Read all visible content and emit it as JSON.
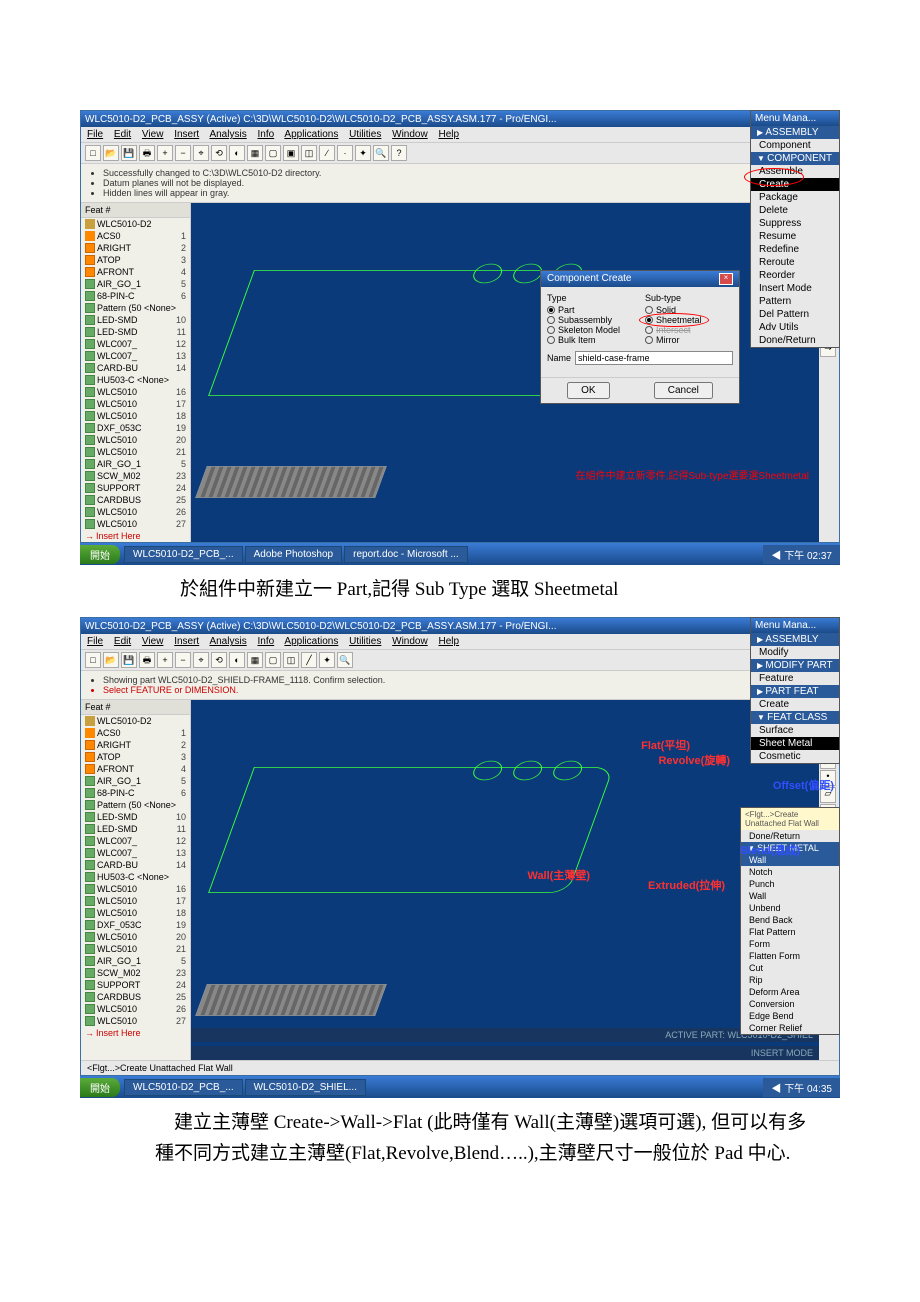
{
  "caption1": "於組件中新建立一 Part,記得 Sub Type 選取 Sheetmetal",
  "caption2": "    建立主薄壁 Create->Wall->Flat (此時僅有 Wall(主薄壁)選項可選), 但可以有多種不同方式建立主薄壁(Flat,Revolve,Blend…..),主薄壁尺寸一般位於 Pad 中心.",
  "shot1": {
    "title": "WLC5010-D2_PCB_ASSY (Active)  C:\\3D\\WLC5010-D2\\WLC5010-D2_PCB_ASSY.ASM.177 - Pro/ENGI...",
    "menus": [
      "File",
      "Edit",
      "View",
      "Insert",
      "Analysis",
      "Info",
      "Applications",
      "Utilities",
      "Window",
      "Help"
    ],
    "messages": [
      "Successfully changed to C:\\3D\\WLC5010-D2 directory.",
      "Datum planes will not be displayed.",
      "Hidden lines will appear in gray."
    ],
    "feat_head": "Feat #",
    "tree": [
      {
        "label": "WLC5010-D2",
        "t": "asm",
        "n": ""
      },
      {
        "label": "ACS0",
        "t": "csys",
        "n": "1"
      },
      {
        "label": "ARIGHT",
        "t": "plane",
        "n": "2"
      },
      {
        "label": "ATOP",
        "t": "plane",
        "n": "3"
      },
      {
        "label": "AFRONT",
        "t": "plane",
        "n": "4"
      },
      {
        "label": "AIR_GO_1",
        "t": "part",
        "n": "5"
      },
      {
        "label": "68-PIN-C",
        "t": "part",
        "n": "6"
      },
      {
        "label": "Pattern (50  <None>",
        "t": "grp",
        "n": ""
      },
      {
        "label": "LED-SMD",
        "t": "part",
        "n": "10"
      },
      {
        "label": "LED-SMD",
        "t": "part",
        "n": "11"
      },
      {
        "label": "WLC007_",
        "t": "part",
        "n": "12"
      },
      {
        "label": "WLC007_",
        "t": "part",
        "n": "13"
      },
      {
        "label": "CARD-BU",
        "t": "part",
        "n": "14"
      },
      {
        "label": "HU503-C  <None>",
        "t": "part",
        "n": ""
      },
      {
        "label": "WLC5010",
        "t": "part",
        "n": "16"
      },
      {
        "label": "WLC5010",
        "t": "part",
        "n": "17"
      },
      {
        "label": "WLC5010",
        "t": "part",
        "n": "18"
      },
      {
        "label": "DXF_053C",
        "t": "part",
        "n": "19"
      },
      {
        "label": "WLC5010",
        "t": "part",
        "n": "20"
      },
      {
        "label": "WLC5010",
        "t": "part",
        "n": "21"
      },
      {
        "label": "AIR_GO_1",
        "t": "part",
        "n": "5"
      },
      {
        "label": "SCW_M02",
        "t": "part",
        "n": "23"
      },
      {
        "label": "SUPPORT",
        "t": "part",
        "n": "24"
      },
      {
        "label": "CARDBUS",
        "t": "part",
        "n": "25"
      },
      {
        "label": "WLC5010",
        "t": "part",
        "n": "26"
      },
      {
        "label": "WLC5010",
        "t": "part",
        "n": "27"
      }
    ],
    "insert": "Insert Here",
    "menu_manager": {
      "title": "Menu Mana...",
      "secs": [
        "ASSEMBLY",
        "Component",
        "COMPONENT"
      ],
      "items": [
        "Assemble",
        "Create",
        "Package",
        "Delete",
        "Suppress",
        "Resume",
        "Redefine",
        "Reroute",
        "Reorder",
        "Insert Mode",
        "Pattern",
        "Del Pattern",
        "Adv Utils",
        "Done/Return"
      ],
      "selected": "Create"
    },
    "dialog": {
      "title": "Component Create",
      "type_label": "Type",
      "subtype_label": "Sub-type",
      "types": [
        "Part",
        "Subassembly",
        "Skeleton Model",
        "Bulk Item"
      ],
      "subtypes": [
        "Solid",
        "Sheetmetal",
        "Intersect",
        "Mirror"
      ],
      "type_selected": "Part",
      "subtype_selected": "Sheetmetal",
      "name_label": "Name",
      "name_value": "shield-case-frame",
      "ok": "OK",
      "cancel": "Cancel"
    },
    "red_note": "在組件中建立新零件,記得Sub-type選要選Sheetmetal",
    "taskbar": {
      "start": "開始",
      "items": [
        "WLC5010-D2_PCB_...",
        "Adobe Photoshop",
        "report.doc - Microsoft ..."
      ],
      "clock": "下午 02:37"
    }
  },
  "shot2": {
    "title": "WLC5010-D2_PCB_ASSY (Active)  C:\\3D\\WLC5010-D2\\WLC5010-D2_PCB_ASSY.ASM.177 - Pro/ENGI...",
    "menus": [
      "File",
      "Edit",
      "View",
      "Insert",
      "Analysis",
      "Info",
      "Applications",
      "Utilities",
      "Window",
      "Help"
    ],
    "messages": [
      "Showing part WLC5010-D2_SHIELD-FRAME_1118. Confirm selection.",
      "Select FEATURE or DIMENSION."
    ],
    "tree_same": true,
    "insert": "Insert Here",
    "footer_hint": "<Flgt...>Create Unattached Flat Wall",
    "status_active": "ACTIVE PART: WLC5010-D2_SHIEL",
    "status_insert": "INSERT MODE",
    "menu_manager": {
      "title": "Menu Mana...",
      "secs": [
        "ASSEMBLY",
        "Modify",
        "MODIFY PART",
        "Feature",
        "PART FEAT",
        "Create",
        "FEAT CLASS"
      ],
      "fc_items": [
        "Surface",
        "Sheet Metal",
        "Cosmetic"
      ],
      "fc_selected": "Sheet Metal",
      "sheet_hint": "<Flgt...>Create Unattached Flat Wall",
      "sheet_sec": "SHEET METAL",
      "sheet_items": [
        "Wall",
        "Notch",
        "Punch",
        "Wall",
        "Unbend",
        "Bend Back",
        "Flat Pattern",
        "Form",
        "Flatten Form",
        "Cut",
        "Rip",
        "Deform Area",
        "Conversion",
        "Edge Bend",
        "Corner Relief"
      ],
      "done": "Done/Return"
    },
    "annotations": {
      "flat": "Flat(平坦)",
      "revolve": "Revolve(旋轉)",
      "offset": "Offset(偏距)",
      "wall": "Wall(主薄壁)",
      "blend": "Blend(混成)",
      "extruded": "Extruded(拉伸)"
    },
    "taskbar": {
      "start": "開始",
      "items": [
        "WLC5010-D2_PCB_...",
        "WLC5010-D2_SHIEL..."
      ],
      "clock": "下午 04:35"
    }
  }
}
